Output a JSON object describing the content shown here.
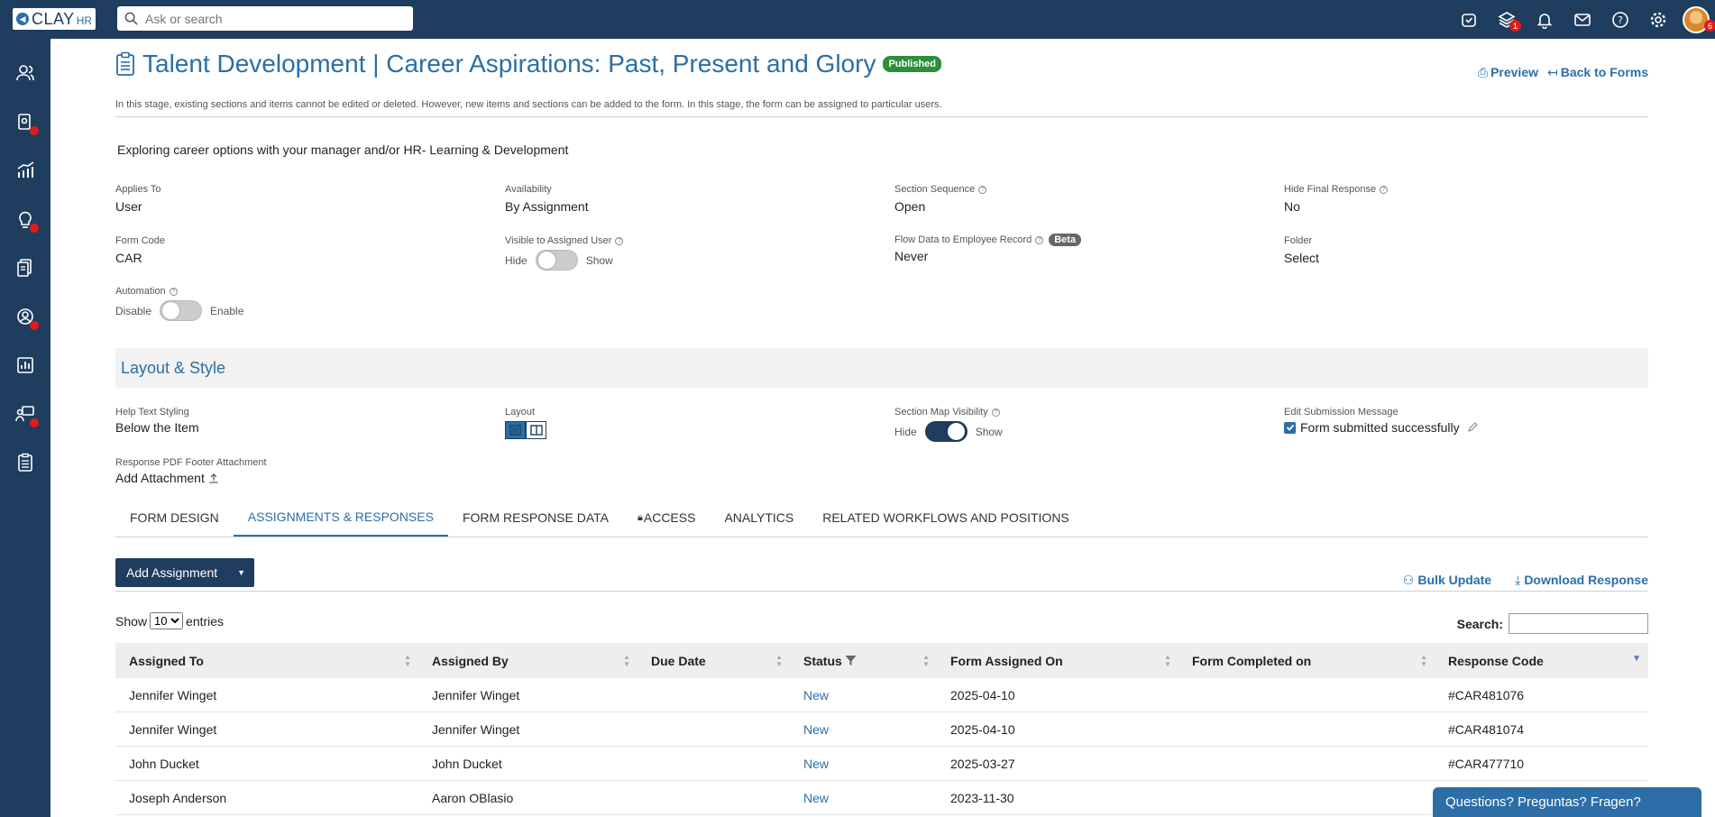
{
  "app": {
    "logo_text": "CLAY",
    "logo_suffix": "HR"
  },
  "topbar": {
    "search_placeholder": "Ask or search",
    "icons": [
      "alarm-icon",
      "layers-icon",
      "bell-icon",
      "mail-icon",
      "help-icon",
      "gear-icon",
      "avatar"
    ],
    "layers_badge": "1",
    "avatar_badge": "6"
  },
  "form": {
    "title": "Talent Development | Career Aspirations: Past, Present and Glory",
    "status_badge": "Published",
    "preview_label": "Preview",
    "back_label": "Back to Forms",
    "stage_note": "In this stage, existing sections and items cannot be edited or deleted. However, new items and sections can be added to the form. In this stage, the form can be assigned to particular users.",
    "description": "Exploring career options with your manager and/or HR- Learning & Development"
  },
  "fields": {
    "applies_to": {
      "label": "Applies To",
      "value": "User"
    },
    "availability": {
      "label": "Availability",
      "value": "By Assignment"
    },
    "section_sequence": {
      "label": "Section Sequence",
      "value": "Open"
    },
    "hide_final_response": {
      "label": "Hide Final Response",
      "value": "No"
    },
    "form_code": {
      "label": "Form Code",
      "value": "CAR"
    },
    "visible_to_user": {
      "label": "Visible to Assigned User",
      "off": "Hide",
      "on": "Show"
    },
    "flow_data": {
      "label": "Flow Data to Employee Record",
      "badge": "Beta",
      "value": "Never"
    },
    "folder": {
      "label": "Folder",
      "value": "Select"
    },
    "automation": {
      "label": "Automation",
      "off": "Disable",
      "on": "Enable"
    }
  },
  "layout_style": {
    "heading": "Layout & Style",
    "help_text_styling": {
      "label": "Help Text Styling",
      "value": "Below the Item"
    },
    "layout": {
      "label": "Layout"
    },
    "section_map": {
      "label": "Section Map Visibility",
      "off": "Hide",
      "on": "Show"
    },
    "edit_submission": {
      "label": "Edit Submission Message",
      "value": "Form submitted successfully"
    },
    "pdf_footer": {
      "label": "Response PDF Footer Attachment",
      "value": "Add Attachment"
    }
  },
  "tabs": [
    {
      "label": "FORM DESIGN"
    },
    {
      "label": "ASSIGNMENTS & RESPONSES"
    },
    {
      "label": "FORM RESPONSE DATA"
    },
    {
      "label": "ACCESS"
    },
    {
      "label": "ANALYTICS"
    },
    {
      "label": "RELATED WORKFLOWS AND POSITIONS"
    }
  ],
  "assignments": {
    "add_button": "Add Assignment",
    "bulk_update": "Bulk Update",
    "download_response": "Download Response",
    "show_label": "Show",
    "entries_value": "10",
    "entries_label": "entries",
    "search_label": "Search:",
    "columns": [
      "Assigned To",
      "Assigned By",
      "Due Date",
      "Status",
      "Form Assigned On",
      "Form Completed on",
      "Response Code"
    ],
    "rows": [
      [
        "Jennifer Winget",
        "Jennifer Winget",
        "",
        "New",
        "2025-04-10",
        "",
        "#CAR481076"
      ],
      [
        "Jennifer Winget",
        "Jennifer Winget",
        "",
        "New",
        "2025-04-10",
        "",
        "#CAR481074"
      ],
      [
        "John Ducket",
        "John Ducket",
        "",
        "New",
        "2025-03-27",
        "",
        "#CAR477710"
      ],
      [
        "Joseph Anderson",
        "Aaron OBlasio",
        "",
        "New",
        "2023-11-30",
        "",
        ""
      ]
    ]
  },
  "chat": {
    "label": "Questions? Preguntas? Fragen?"
  },
  "colors": {
    "navy": "#1f3d5e",
    "link": "#2a6fa8",
    "published": "#2c8f3a",
    "badge": "#e21b1b"
  }
}
